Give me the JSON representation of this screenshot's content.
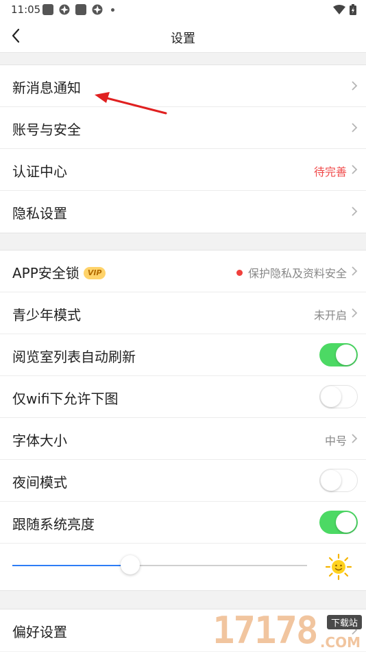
{
  "status_bar": {
    "time": "11:05"
  },
  "nav": {
    "title": "设置"
  },
  "group1": [
    {
      "label": "新消息通知"
    },
    {
      "label": "账号与安全"
    },
    {
      "label": "认证中心",
      "value": "待完善"
    },
    {
      "label": "隐私设置"
    }
  ],
  "group2": {
    "app_lock": {
      "label": "APP安全锁",
      "badge": "VIP",
      "value": "保护隐私及资料安全"
    },
    "teen_mode": {
      "label": "青少年模式",
      "value": "未开启"
    },
    "auto_refresh": {
      "label": "阅览室列表自动刷新",
      "on": true
    },
    "wifi_images": {
      "label": "仅wifi下允许下图",
      "on": false
    },
    "font_size": {
      "label": "字体大小",
      "value": "中号"
    },
    "night_mode": {
      "label": "夜间模式",
      "on": false
    },
    "follow_brightness": {
      "label": "跟随系统亮度",
      "on": true
    },
    "brightness_level": 0.4
  },
  "group3": [
    {
      "label": "偏好设置"
    }
  ],
  "watermark": {
    "number": "17178",
    "tag": "下载站",
    "suffix": ".COM"
  },
  "colors": {
    "toggle_on": "#4cd964",
    "accent_blue": "#2d7df6",
    "warning_red": "#f04a4a"
  }
}
